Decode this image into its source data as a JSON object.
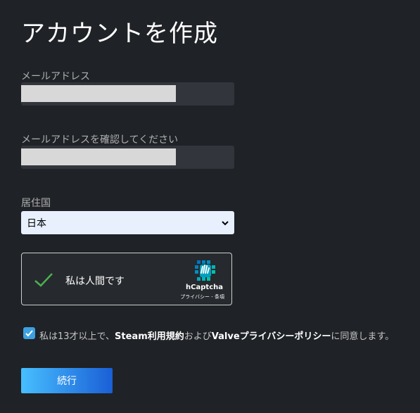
{
  "page": {
    "title": "アカウントを作成"
  },
  "form": {
    "email_label": "メールアドレス",
    "confirm_email_label": "メールアドレスを確認してください",
    "country_label": "居住国",
    "country_value": "日本"
  },
  "captcha": {
    "text": "私は人間です",
    "brand": "hCaptcha",
    "links": "プライバシー - 条項"
  },
  "agreement": {
    "prefix": "私は13才以上で、",
    "steam_terms": "Steam利用規約",
    "and": "および",
    "valve_privacy": "Valveプライバシーポリシー",
    "suffix": "に同意します。",
    "checked": true
  },
  "buttons": {
    "continue": "続行"
  },
  "colors": {
    "accent": "#3da0e0",
    "checkmark": "#4caf50",
    "background": "#1f2226"
  },
  "icons": [
    "check-icon",
    "hcaptcha-logo-icon",
    "chevron-down-icon"
  ]
}
